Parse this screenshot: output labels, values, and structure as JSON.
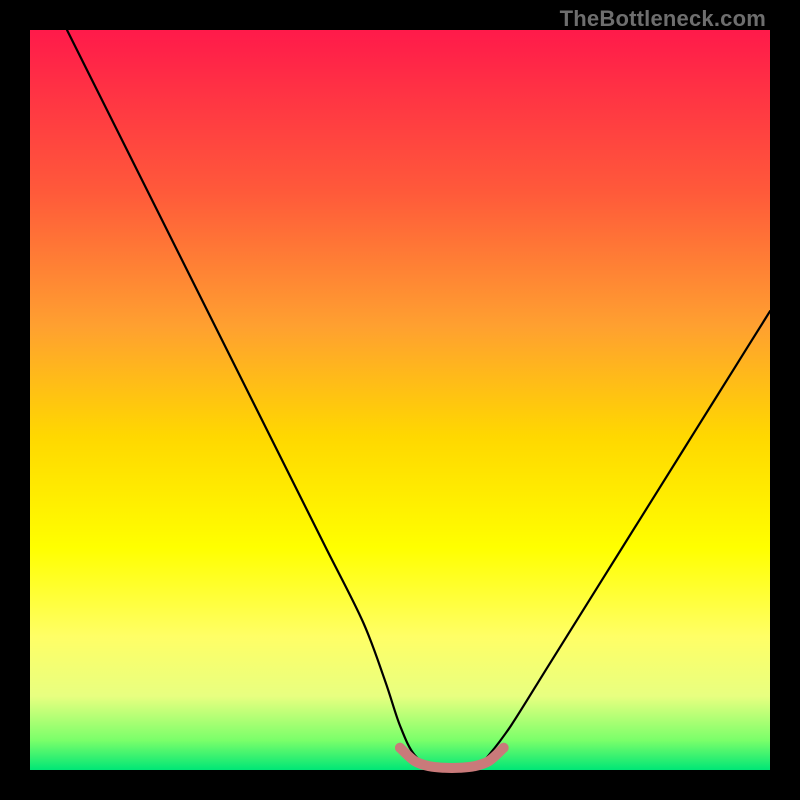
{
  "watermark": "TheBottleneck.com",
  "chart_data": {
    "type": "line",
    "title": "",
    "xlabel": "",
    "ylabel": "",
    "xlim": [
      0,
      100
    ],
    "ylim": [
      0,
      100
    ],
    "grid": false,
    "legend": false,
    "series": [
      {
        "name": "black-curve",
        "color": "#000000",
        "x": [
          5,
          10,
          15,
          20,
          25,
          30,
          35,
          40,
          45,
          48,
          50,
          52,
          55,
          58,
          60,
          62,
          65,
          70,
          75,
          80,
          85,
          90,
          95,
          100
        ],
        "values": [
          100,
          90,
          80,
          70,
          60,
          50,
          40,
          30,
          20,
          12,
          6,
          2,
          0,
          0,
          0,
          2,
          6,
          14,
          22,
          30,
          38,
          46,
          54,
          62
        ]
      },
      {
        "name": "ideal-zone",
        "color": "#c97a7a",
        "x": [
          50,
          52,
          54,
          56,
          58,
          60,
          62,
          64
        ],
        "values": [
          3,
          1.2,
          0.5,
          0.3,
          0.3,
          0.5,
          1.2,
          3
        ]
      }
    ],
    "gradient_stops": [
      {
        "pos": 0,
        "color": "#ff1a4a"
      },
      {
        "pos": 22,
        "color": "#ff5a3a"
      },
      {
        "pos": 40,
        "color": "#ffa030"
      },
      {
        "pos": 55,
        "color": "#ffd800"
      },
      {
        "pos": 70,
        "color": "#ffff00"
      },
      {
        "pos": 82,
        "color": "#ffff66"
      },
      {
        "pos": 90,
        "color": "#e8ff80"
      },
      {
        "pos": 96,
        "color": "#7aff6a"
      },
      {
        "pos": 100,
        "color": "#00e676"
      }
    ]
  }
}
